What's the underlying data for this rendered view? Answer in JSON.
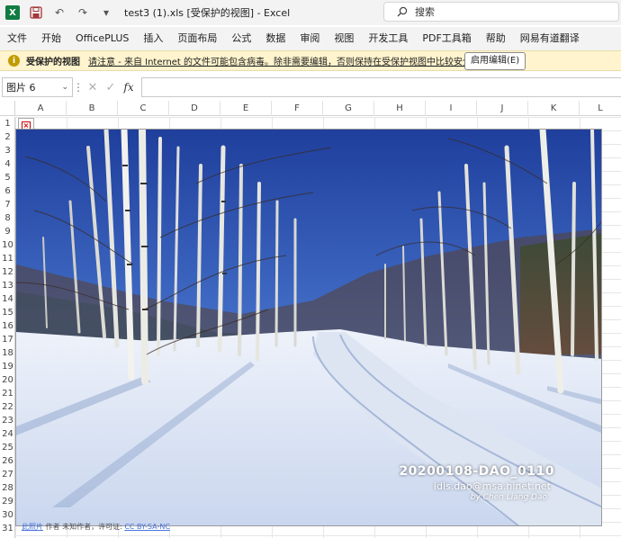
{
  "titlebar": {
    "app_icon_letter": "X",
    "document_title": "test3 (1).xls  [受保护的视图]  -  Excel",
    "search_placeholder": "搜索",
    "undo_glyph": "↶",
    "redo_glyph": "↷",
    "customize_glyph": "▾"
  },
  "ribbon": {
    "tabs": [
      "文件",
      "开始",
      "OfficePLUS",
      "插入",
      "页面布局",
      "公式",
      "数据",
      "审阅",
      "视图",
      "开发工具",
      "PDF工具箱",
      "帮助",
      "网易有道翻译"
    ]
  },
  "protected_view": {
    "title": "受保护的视图",
    "message": "请注意 - 来自 Internet 的文件可能包含病毒。除非需要编辑，否则保持在受保护视图中比较安全。",
    "enable_button": "启用编辑(E)",
    "icon": "shield-info-icon",
    "bg_color": "#fff4ce"
  },
  "formula_bar": {
    "name_box": "图片 6",
    "fx_label": "fx",
    "cancel_glyph": "✕",
    "enter_glyph": "✓",
    "formula": ""
  },
  "columns": [
    "A",
    "B",
    "C",
    "D",
    "E",
    "F",
    "G",
    "H",
    "I",
    "J",
    "K",
    "L"
  ],
  "rows": [
    "1",
    "2",
    "3",
    "4",
    "5",
    "6",
    "7",
    "8",
    "9",
    "10",
    "11",
    "12",
    "13",
    "14",
    "15",
    "16",
    "17",
    "18",
    "19",
    "20",
    "21",
    "22",
    "23",
    "24",
    "25",
    "26",
    "27",
    "28",
    "29",
    "30",
    "31"
  ],
  "picture": {
    "name": "图片 6",
    "watermark_id": "20200108-DAO_0110",
    "watermark_email": "idis.dao@msa.hinet.net",
    "watermark_author": "by Chen Liang Dao"
  },
  "credit": {
    "source_link": "此照片",
    "author_text": " 作者 未知作者，许可证: ",
    "license_link": "CC BY-SA-NC"
  }
}
